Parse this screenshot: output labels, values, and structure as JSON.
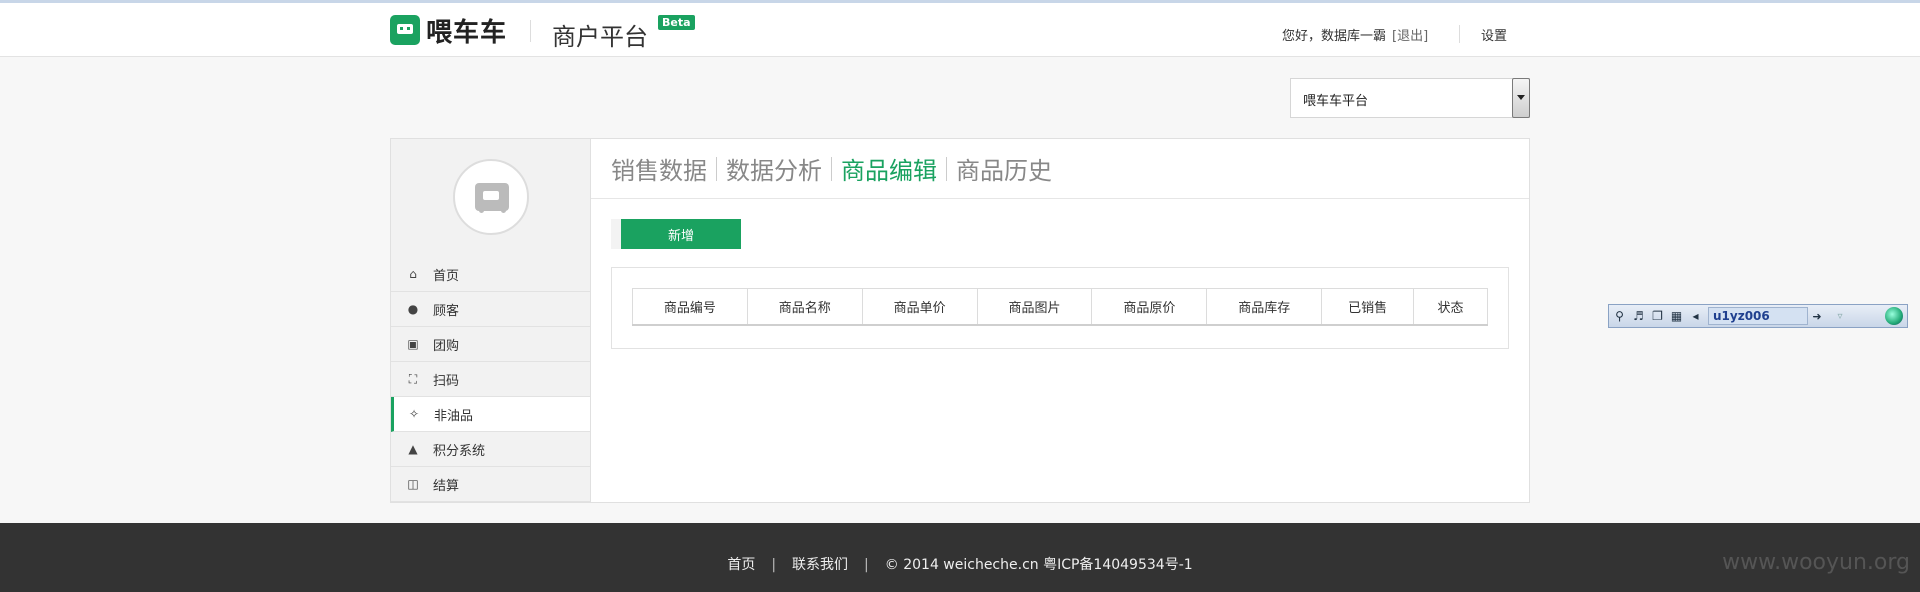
{
  "header": {
    "logo_text": "喂车车",
    "platform": "商户平台",
    "beta": "Beta",
    "greeting": "您好，数据库一霸",
    "logout": "[退出]",
    "settings": "设置"
  },
  "selector": {
    "value": "喂车车平台"
  },
  "sidebar": {
    "items": [
      {
        "label": "首页",
        "icon": "home-icon"
      },
      {
        "label": "顾客",
        "icon": "user-icon"
      },
      {
        "label": "团购",
        "icon": "cart-icon"
      },
      {
        "label": "扫码",
        "icon": "scan-icon"
      },
      {
        "label": "非油品",
        "icon": "puzzle-icon"
      },
      {
        "label": "积分系统",
        "icon": "money-bag-icon"
      },
      {
        "label": "结算",
        "icon": "settlement-icon"
      }
    ],
    "active_index": 4
  },
  "tabs": [
    "销售数据",
    "数据分析",
    "商品编辑",
    "商品历史"
  ],
  "active_tab": 2,
  "add_button": "新增",
  "table": {
    "headers": [
      "商品编号",
      "商品名称",
      "商品单价",
      "商品图片",
      "商品原价",
      "商品库存",
      "已销售",
      "状态"
    ]
  },
  "toolbar": {
    "input_value": "u1yz006"
  },
  "footer": {
    "home": "首页",
    "contact": "联系我们",
    "sep": "|",
    "copyright": "© 2014 weicheche.cn 粤ICP备14049534号-1"
  },
  "watermark": "www.wooyun.org",
  "colors": {
    "accent": "#1aa260",
    "footer_bg": "#333333"
  }
}
